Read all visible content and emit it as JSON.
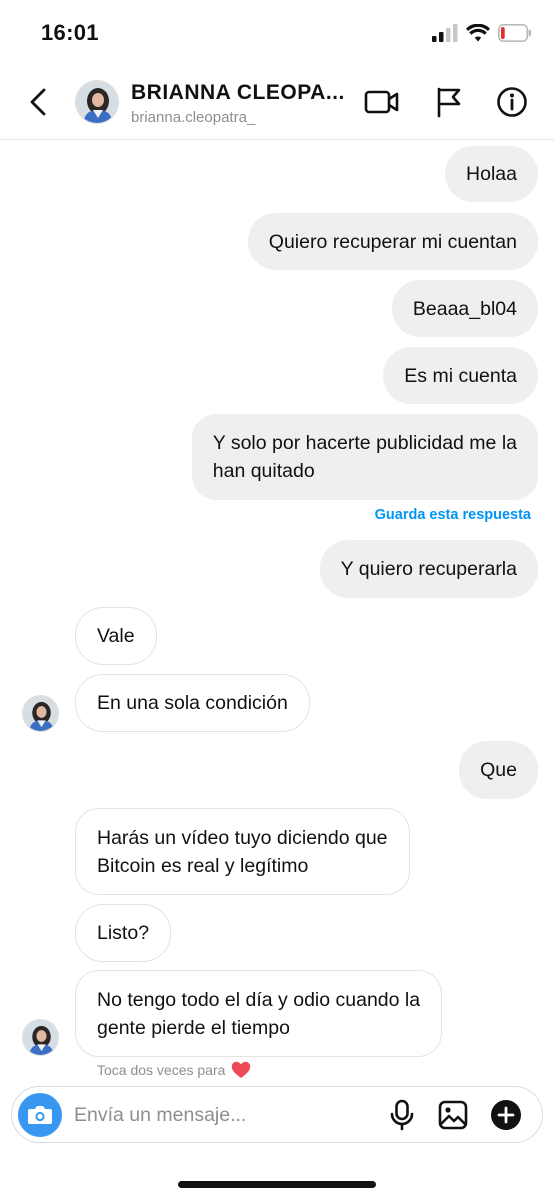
{
  "status_bar": {
    "time": "16:01",
    "battery_level": 0.15,
    "battery_color": "#e0312f"
  },
  "header": {
    "contact_name": "BRIANNA CLEOPA...",
    "username": "brianna.cleopatra_",
    "icons": [
      "back-chevron-icon",
      "video-camera-icon",
      "flag-icon",
      "info-icon"
    ]
  },
  "messages": [
    {
      "direction": "outgoing",
      "text": "Holaa"
    },
    {
      "direction": "outgoing",
      "text": "Quiero recuperar mi cuentan"
    },
    {
      "direction": "outgoing",
      "text": "Beaaa_bl04"
    },
    {
      "direction": "outgoing",
      "text": "Es mi cuenta"
    },
    {
      "direction": "outgoing",
      "lines": [
        "Y solo por hacerte publicidad me la",
        "han quitado"
      ]
    },
    {
      "direction": "outgoing",
      "text": "Y quiero recuperarla"
    },
    {
      "direction": "incoming",
      "text": "Vale"
    },
    {
      "direction": "incoming",
      "text": "En una sola condición"
    },
    {
      "direction": "outgoing",
      "text": "Que"
    },
    {
      "direction": "incoming",
      "lines": [
        "Harás un vídeo tuyo diciendo que",
        "Bitcoin es real y legítimo"
      ]
    },
    {
      "direction": "incoming",
      "text": "Listo?"
    },
    {
      "direction": "incoming",
      "lines": [
        "No tengo todo el día y odio cuando la",
        "gente pierde el tiempo"
      ]
    }
  ],
  "save_reply_link": "Guarda esta respuesta",
  "double_tap_hint": "Toca dos veces para",
  "composer": {
    "placeholder": "Envía un mensaje...",
    "icons": [
      "camera-icon",
      "microphone-icon",
      "gallery-icon",
      "add-icon"
    ]
  },
  "colors": {
    "accent": "#0095f6",
    "camera_button": "#3897f0",
    "outgoing_bubble": "#efefef",
    "heart": "#ed4956"
  }
}
